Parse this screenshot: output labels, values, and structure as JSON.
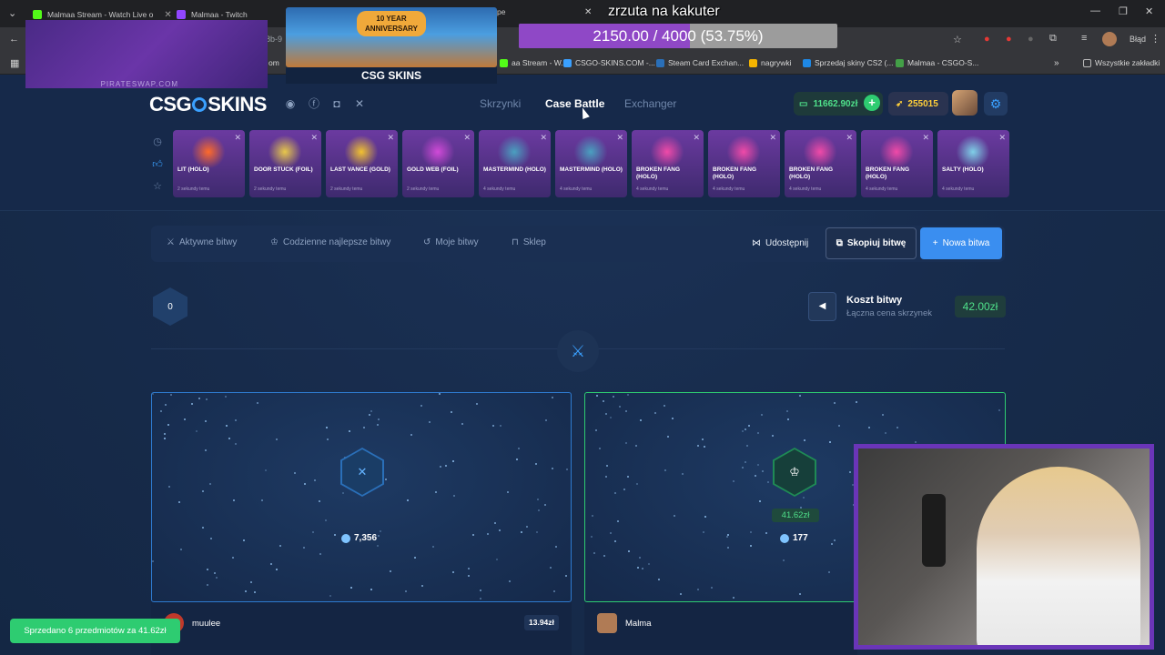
{
  "browser": {
    "tabs": [
      {
        "label": "Malmaa Stream - Watch Live o",
        "color": "#53fc18"
      },
      {
        "label": "Malmaa - Twitch",
        "color": "#9146ff"
      }
    ],
    "bookmarks": [
      {
        "label": "aa Stream - W...",
        "color": "#53fc18"
      },
      {
        "label": "CSGO-SKINS.COM -...",
        "color": "#3aa0ff"
      },
      {
        "label": "Steam Card Exchan...",
        "color": "#2a6fb8"
      },
      {
        "label": "nagrywki",
        "color": "#f4b400"
      },
      {
        "label": "Sprzedaj skiny CS2 (...",
        "color": "#1e88e5"
      },
      {
        "label": "Malmaa - CSGO-S...",
        "color": "#43a047"
      }
    ],
    "all_bookmarks": "Wszystkie zakładki",
    "profile_status": "Błąd",
    "url_fragment": "8b-9",
    "url_fragment2": "om",
    "tab_fragment": "pe"
  },
  "site": {
    "logo_left": "CSG",
    "logo_right": "SKINS",
    "nav": [
      "Skrzynki",
      "Case Battle",
      "Exchanger"
    ],
    "balance": "11662.90zł",
    "points": "255015",
    "recent_drops": [
      {
        "name": "LIT (HOLO)",
        "time": "2 sekundy temu",
        "color": "#ff6a2a"
      },
      {
        "name": "DOOR STUCK (FOIL)",
        "time": "2 sekundy temu",
        "color": "#e8c84a"
      },
      {
        "name": "LAST VANCE (GOLD)",
        "time": "2 sekundy temu",
        "color": "#f2c230"
      },
      {
        "name": "GOLD WEB (FOIL)",
        "time": "2 sekundy temu",
        "color": "#d14ad8"
      },
      {
        "name": "MASTERMIND (HOLO)",
        "time": "4 sekundy temu",
        "color": "#4aa0c0"
      },
      {
        "name": "MASTERMIND (HOLO)",
        "time": "4 sekundy temu",
        "color": "#4aa0c0"
      },
      {
        "name": "BROKEN FANG (HOLO)",
        "time": "4 sekundy temu",
        "color": "#f04aa8"
      },
      {
        "name": "BROKEN FANG (HOLO)",
        "time": "4 sekundy temu",
        "color": "#f04aa8"
      },
      {
        "name": "BROKEN FANG (HOLO)",
        "time": "4 sekundy temu",
        "color": "#f04aa8"
      },
      {
        "name": "BROKEN FANG (HOLO)",
        "time": "4 sekundy temu",
        "color": "#f04aa8"
      },
      {
        "name": "SALTY (HOLO)",
        "time": "4 sekundy temu",
        "color": "#7fd0e8"
      }
    ],
    "toolbar": {
      "active": "Aktywne bitwy",
      "daily": "Codzienne najlepsze bitwy",
      "mine": "Moje bitwy",
      "shop": "Sklep",
      "share": "Udostępnij",
      "copy": "Skopiuj bitwę",
      "new": "Nowa bitwa"
    },
    "battle": {
      "round": "0",
      "cost_title": "Koszt bitwy",
      "cost_sub": "Łączna cena skrzynek",
      "cost_value": "42.00zł"
    },
    "players": [
      {
        "name": "muulee",
        "points": "7,356",
        "value": "13.94zł",
        "avatar": "#c0392b"
      },
      {
        "name": "Malma",
        "points": "177",
        "win": "41.62zł",
        "avatar": "#b07b55"
      }
    ]
  },
  "overlay": {
    "watermark": "PIRATESWAP.COM",
    "anniversary": "10 YEAR ANNIVERSARY",
    "banner_logo": "CSG SKINS",
    "goal_title": "zrzuta na kakuter",
    "goal_text": "2150.00 / 4000 (53.75%)",
    "goal_fraction": 0.5375,
    "toast": "Sprzedano 6 przedmiotów za 41.62zł"
  }
}
